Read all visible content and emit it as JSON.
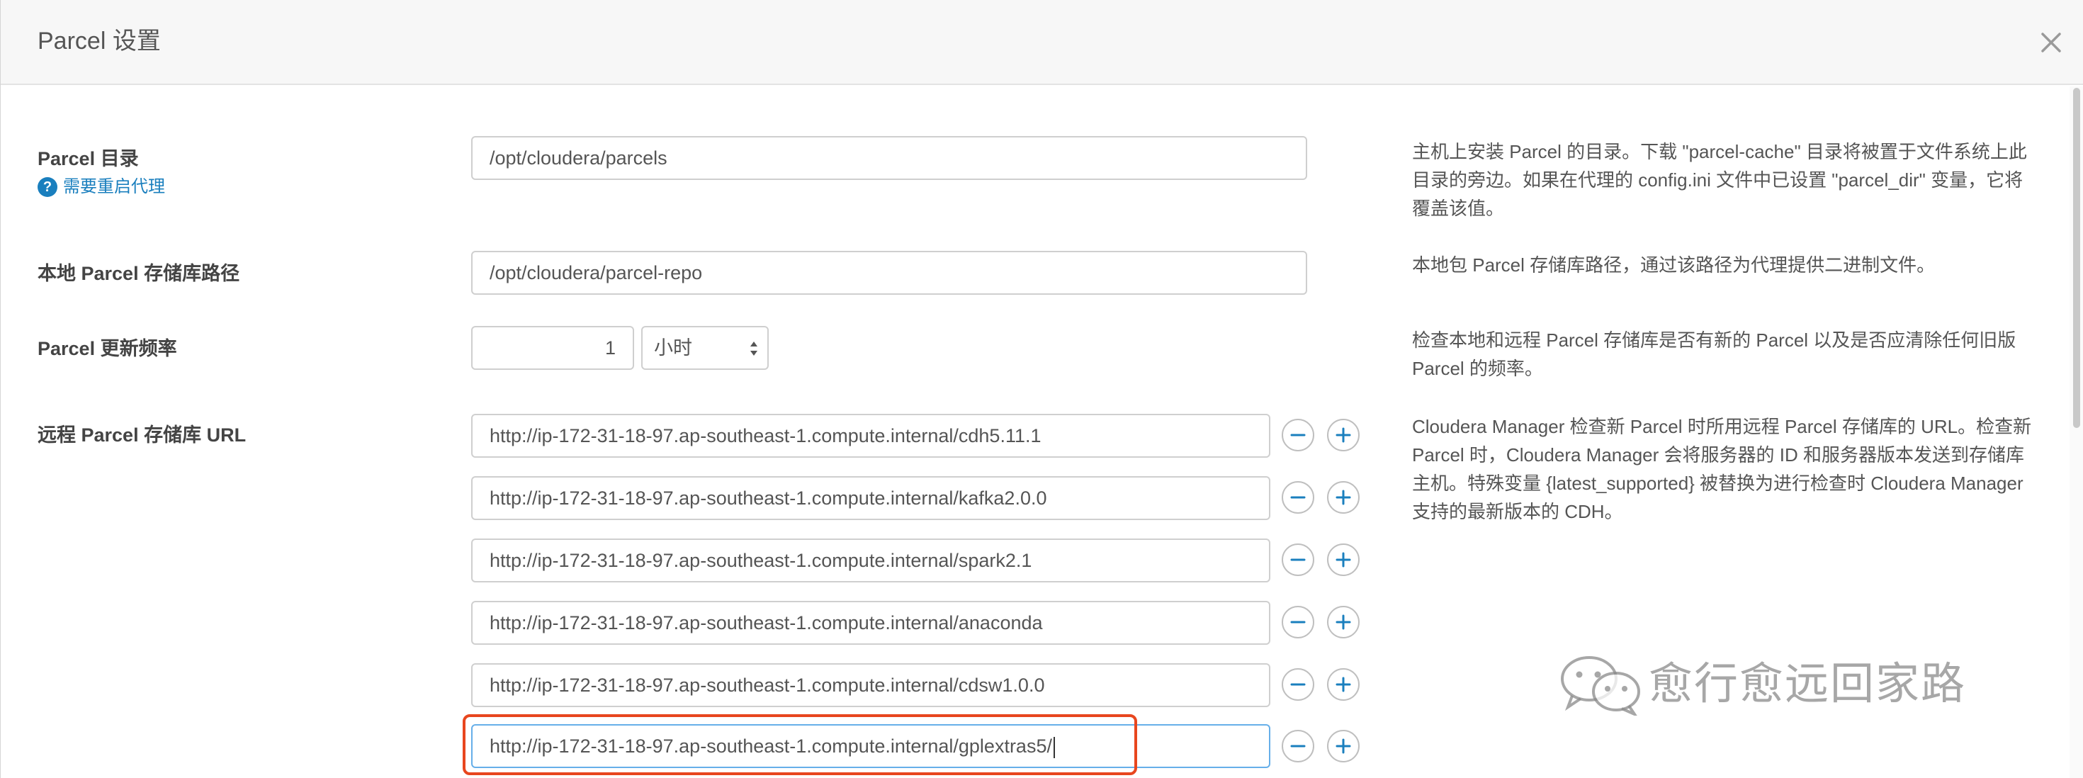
{
  "dialog": {
    "title": "Parcel 设置",
    "close_icon": "close-icon"
  },
  "fields": {
    "parcel_dir": {
      "label": "Parcel 目录",
      "restart_note": "需要重启代理",
      "value": "/opt/cloudera/parcels",
      "help": "主机上安装 Parcel 的目录。下载 \"parcel-cache\" 目录将被置于文件系统上此目录的旁边。如果在代理的 config.ini 文件中已设置 \"parcel_dir\" 变量，它将覆盖该值。"
    },
    "local_repo": {
      "label": "本地 Parcel 存储库路径",
      "value": "/opt/cloudera/parcel-repo",
      "help": "本地包 Parcel 存储库路径，通过该路径为代理提供二进制文件。"
    },
    "update_freq": {
      "label": "Parcel 更新频率",
      "value": "1",
      "unit": "小时",
      "help": "检查本地和远程 Parcel 存储库是否有新的 Parcel 以及是否应清除任何旧版 Parcel 的频率。"
    },
    "remote_urls": {
      "label": "远程 Parcel 存储库 URL",
      "urls": [
        "http://ip-172-31-18-97.ap-southeast-1.compute.internal/cdh5.11.1",
        "http://ip-172-31-18-97.ap-southeast-1.compute.internal/kafka2.0.0",
        "http://ip-172-31-18-97.ap-southeast-1.compute.internal/spark2.1",
        "http://ip-172-31-18-97.ap-southeast-1.compute.internal/anaconda",
        "http://ip-172-31-18-97.ap-southeast-1.compute.internal/cdsw1.0.0",
        "http://ip-172-31-18-97.ap-southeast-1.compute.internal/gplextras5/"
      ],
      "help": "Cloudera Manager 检查新 Parcel 时所用远程 Parcel 存储库的 URL。检查新 Parcel 时，Cloudera Manager 会将服务器的 ID 和服务器版本发送到存储库主机。特殊变量 {latest_supported} 被替换为进行检查时 Cloudera Manager 支持的最新版本的 CDH。"
    }
  },
  "watermark": {
    "text": "愈行愈远回家路",
    "icon": "wechat-icon"
  },
  "colors": {
    "link": "#1a7fbe",
    "highlight": "#e8461e",
    "header_bg": "#f7f7f7"
  }
}
